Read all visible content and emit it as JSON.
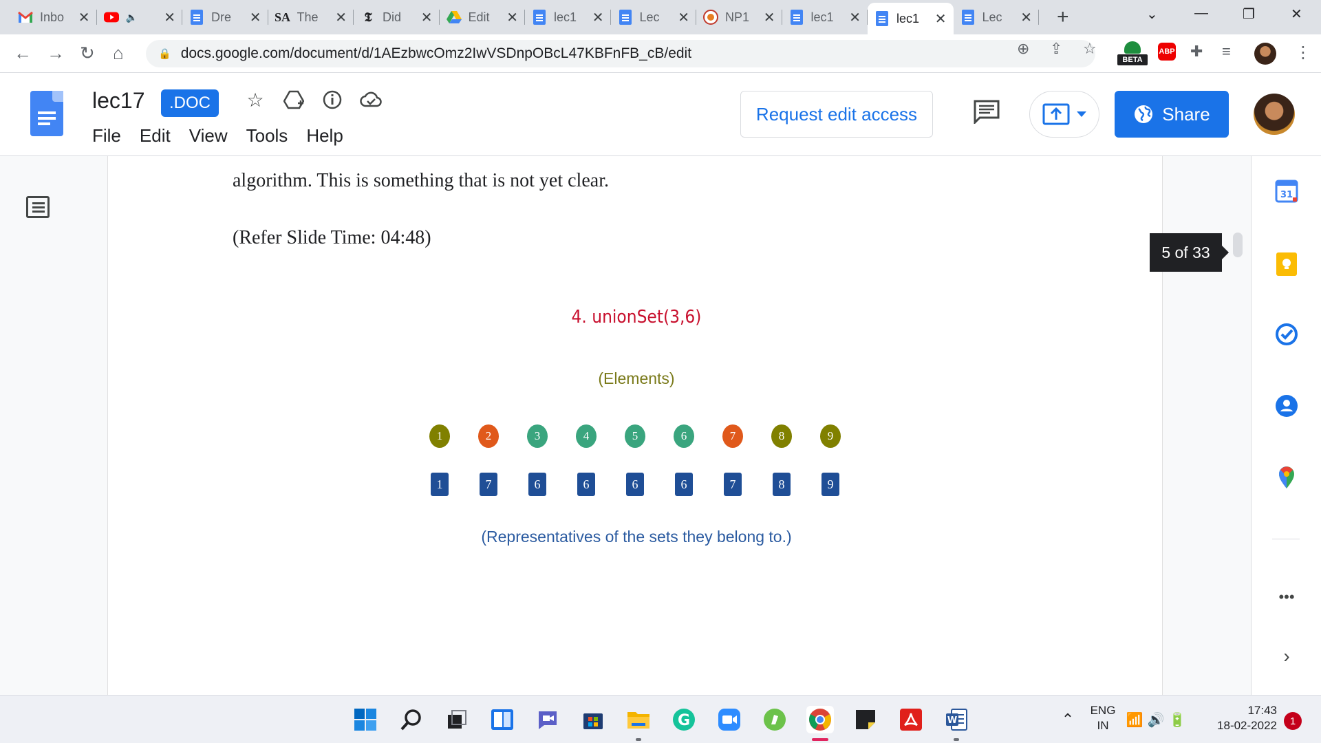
{
  "browser": {
    "tabs": [
      {
        "title": "Inbo",
        "icon": "gmail-icon"
      },
      {
        "title": "",
        "icon": "youtube-icon",
        "muted_glyph": "🔈"
      },
      {
        "title": "Dre",
        "icon": "docs-icon"
      },
      {
        "title": "The",
        "icon": "sa-icon",
        "badge": "SA"
      },
      {
        "title": "Did",
        "icon": "nyt-icon",
        "badge": "𝕿"
      },
      {
        "title": "Edit",
        "icon": "drive-icon"
      },
      {
        "title": "lec1",
        "icon": "docs-icon"
      },
      {
        "title": "Lec",
        "icon": "docs-icon"
      },
      {
        "title": "NP1",
        "icon": "nptel-icon"
      },
      {
        "title": "lec1",
        "icon": "docs-icon"
      },
      {
        "title": "lec1",
        "icon": "docs-icon",
        "active": true
      },
      {
        "title": "Lec",
        "icon": "docs-icon"
      }
    ],
    "close_glyph": "✕",
    "new_tab_glyph": "+",
    "url": "docs.google.com/document/d/1AEzbwcOmz2IwVSDnpOBcL47KBFnFB_cB/edit",
    "beta_label": "BETA",
    "abp_label": "ABP"
  },
  "docs": {
    "title": "lec17",
    "badge": ".DOC",
    "menu": [
      "File",
      "Edit",
      "View",
      "Tools",
      "Help"
    ],
    "request_access": "Request edit access",
    "share": "Share"
  },
  "document": {
    "paragraph_1": "algorithm. This is something that is not yet clear.",
    "paragraph_2": "(Refer Slide Time: 04:48)",
    "slide": {
      "title": "4. unionSet(3,6)",
      "elements_label": "(Elements)",
      "representatives_label": "(Representatives of the sets they belong to.)",
      "elements": [
        {
          "label": "1",
          "color": "#808000"
        },
        {
          "label": "2",
          "color": "#e0591b"
        },
        {
          "label": "3",
          "color": "#3aa57e"
        },
        {
          "label": "4",
          "color": "#3aa57e"
        },
        {
          "label": "5",
          "color": "#3aa57e"
        },
        {
          "label": "6",
          "color": "#3aa57e"
        },
        {
          "label": "7",
          "color": "#e0591b"
        },
        {
          "label": "8",
          "color": "#808000"
        },
        {
          "label": "9",
          "color": "#808000"
        }
      ],
      "representatives": [
        "1",
        "7",
        "6",
        "6",
        "6",
        "6",
        "7",
        "8",
        "9"
      ],
      "colors": {
        "title": "#c8102e",
        "elements_label": "#7a7a1a",
        "representatives_label": "#2a5aa0",
        "square": "#1f4e96"
      }
    }
  },
  "page_tooltip": "5 of 33",
  "taskbar": {
    "lang_top": "ENG",
    "lang_bottom": "IN",
    "time": "17:43",
    "date": "18-02-2022",
    "notifications": "1"
  }
}
